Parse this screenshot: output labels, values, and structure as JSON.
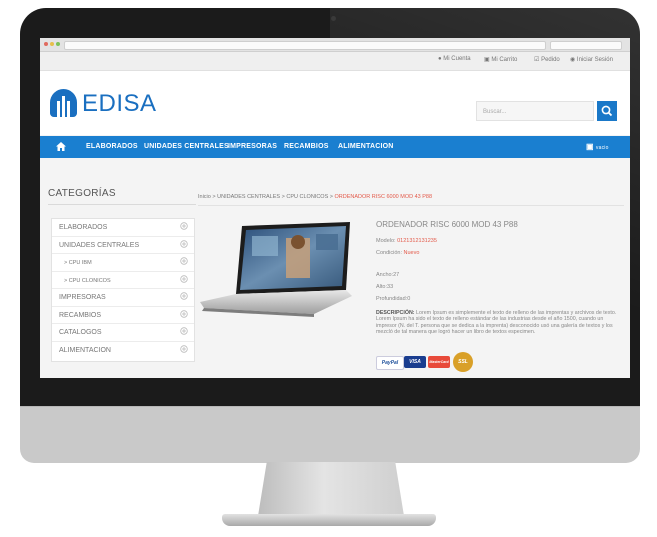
{
  "topbar": {
    "links": [
      {
        "label": "Mi Cuenta",
        "icon": "user-icon"
      },
      {
        "label": "Mi Carrito",
        "icon": "cart-icon"
      },
      {
        "label": "Pedido",
        "icon": "check-icon"
      },
      {
        "label": "Iniciar Sesión",
        "icon": "lock-icon"
      }
    ]
  },
  "brand": {
    "name": "EDISA",
    "color": "#1a6fc0"
  },
  "search": {
    "placeholder": "Buscar...",
    "icon": "search-icon"
  },
  "nav": {
    "home_icon": "home-icon",
    "items": [
      "ELABORADOS",
      "UNIDADES CENTRALES",
      "IMPRESORAS",
      "RECAMBIOS",
      "ALIMENTACION"
    ],
    "cart_label": "vacio",
    "color": "#1a7fd0"
  },
  "sidebar": {
    "title": "CATEGORÍAS",
    "items": [
      {
        "label": "ELABORADOS",
        "sub": false
      },
      {
        "label": "UNIDADES CENTRALES",
        "sub": false
      },
      {
        "label": "> CPU IBM",
        "sub": true
      },
      {
        "label": "> CPU CLONICOS",
        "sub": true
      },
      {
        "label": "IMPRESORAS",
        "sub": false
      },
      {
        "label": "RECAMBIOS",
        "sub": false
      },
      {
        "label": "CATALOGOS",
        "sub": false
      },
      {
        "label": "ALIMENTACION",
        "sub": false
      }
    ]
  },
  "breadcrumb": {
    "home": "Inicio",
    "sep": ">",
    "level1": "UNIDADES CENTRALES",
    "level2": "CPU CLONICOS",
    "current": "ORDENADOR RISC 6000 MOD 43 P88"
  },
  "product": {
    "title": "ORDENADOR RISC 6000 MOD 43 P88",
    "model_label": "Modelo:",
    "model_value": "0121312131235",
    "condition_label": "Condición:",
    "condition_value": "Nuevo",
    "width": "Ancho:27",
    "height": "Alto:33",
    "depth": "Profundidad:0",
    "description_label": "DESCRIPCIÓN:",
    "description": "Lorem Ipsum es simplemente el texto de relleno de las imprentas y archivos de texto. Lorem Ipsum ha sido el texto de relleno estándar de las industrias desde el año 1500, cuando un impresor (N. del T. persona que se dedica a la imprenta) desconocido usó una galería de textos y los mezcló de tal manera que logró hacer un libro de textos especimen."
  },
  "payment": {
    "badges": [
      "PayPal",
      "VISA",
      "MasterCard",
      "SSL"
    ]
  }
}
